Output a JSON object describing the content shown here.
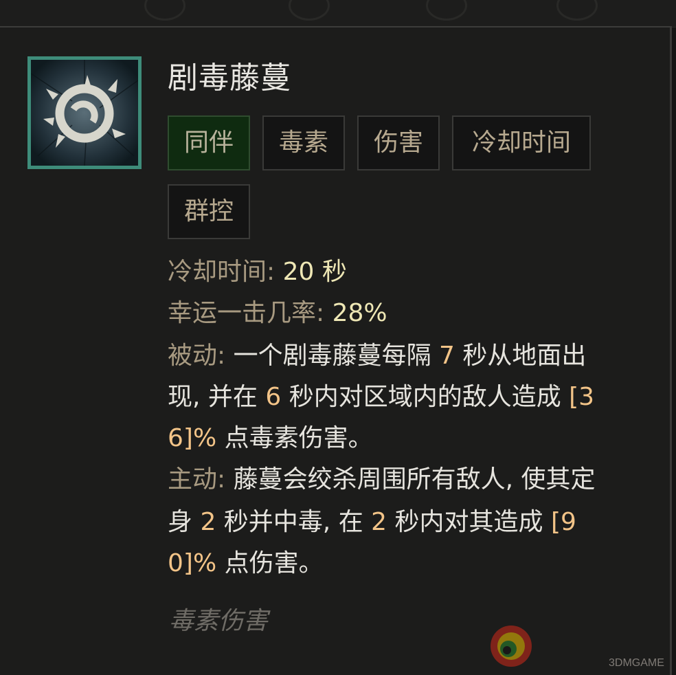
{
  "skill": {
    "name": "剧毒藤蔓",
    "icon": "thorn-vine-icon",
    "tags": [
      "同伴",
      "毒素",
      "伤害",
      "冷却时间",
      "群控"
    ],
    "cooldown_label": "冷却时间:",
    "cooldown_value": "20 秒",
    "lucky_label": "幸运一击几率:",
    "lucky_value": "28%",
    "passive_label": "被动:",
    "passive_l1_a": " 一个剧毒藤蔓每隔 ",
    "passive_l1_n": "7",
    "passive_l1_b": " 秒从地面出",
    "passive_l2_a": "现, 并在 ",
    "passive_l2_n1": "6",
    "passive_l2_b": " 秒内对区域内的敌人造成 ",
    "passive_l2_n2": "[3",
    "passive_l3_n": "6]%",
    "passive_l3_b": " 点毒素伤害。",
    "active_label": "主动:",
    "active_l1_b": " 藤蔓会绞杀周围所有敌人, 使其定",
    "active_l2_a": "身 ",
    "active_l2_n1": "2",
    "active_l2_b": " 秒并中毒, 在 ",
    "active_l2_n2": "2",
    "active_l2_c": " 秒内对其造成 ",
    "active_l2_n3": "[9",
    "active_l3_n": "0]%",
    "active_l3_b": " 点伤害。",
    "footer": "毒素伤害"
  },
  "watermark": {
    "text": "3DMGAME"
  },
  "colors": {
    "frame": "#3e8c7a",
    "tag_active_bg": "#0f2b10",
    "number": "#f3c488",
    "label": "#a89a81"
  }
}
